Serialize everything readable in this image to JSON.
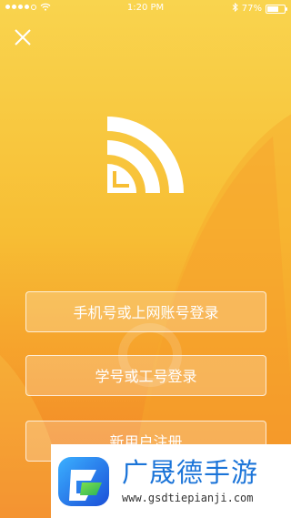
{
  "status_bar": {
    "time": "1:20 PM",
    "battery_percent": "77%",
    "battery_level": 0.77,
    "icons": [
      "signal-dots-icon",
      "wifi-icon",
      "bluetooth-icon",
      "battery-icon"
    ]
  },
  "header": {
    "close_icon": "close-icon"
  },
  "logo": {
    "icon": "wifi-logo-icon"
  },
  "actions": {
    "phone_login_label": "手机号或上网账号登录",
    "student_login_label": "学号或工号登录",
    "register_label": "新用户注册"
  },
  "watermark": {
    "title": "广晟德手游",
    "url": "www.gsdtiepianji.com"
  },
  "colors": {
    "bg_top": "#f9d44e",
    "bg_bottom": "#f17a24",
    "button_text": "#ffffff",
    "watermark_blue": "#1b74d8"
  }
}
